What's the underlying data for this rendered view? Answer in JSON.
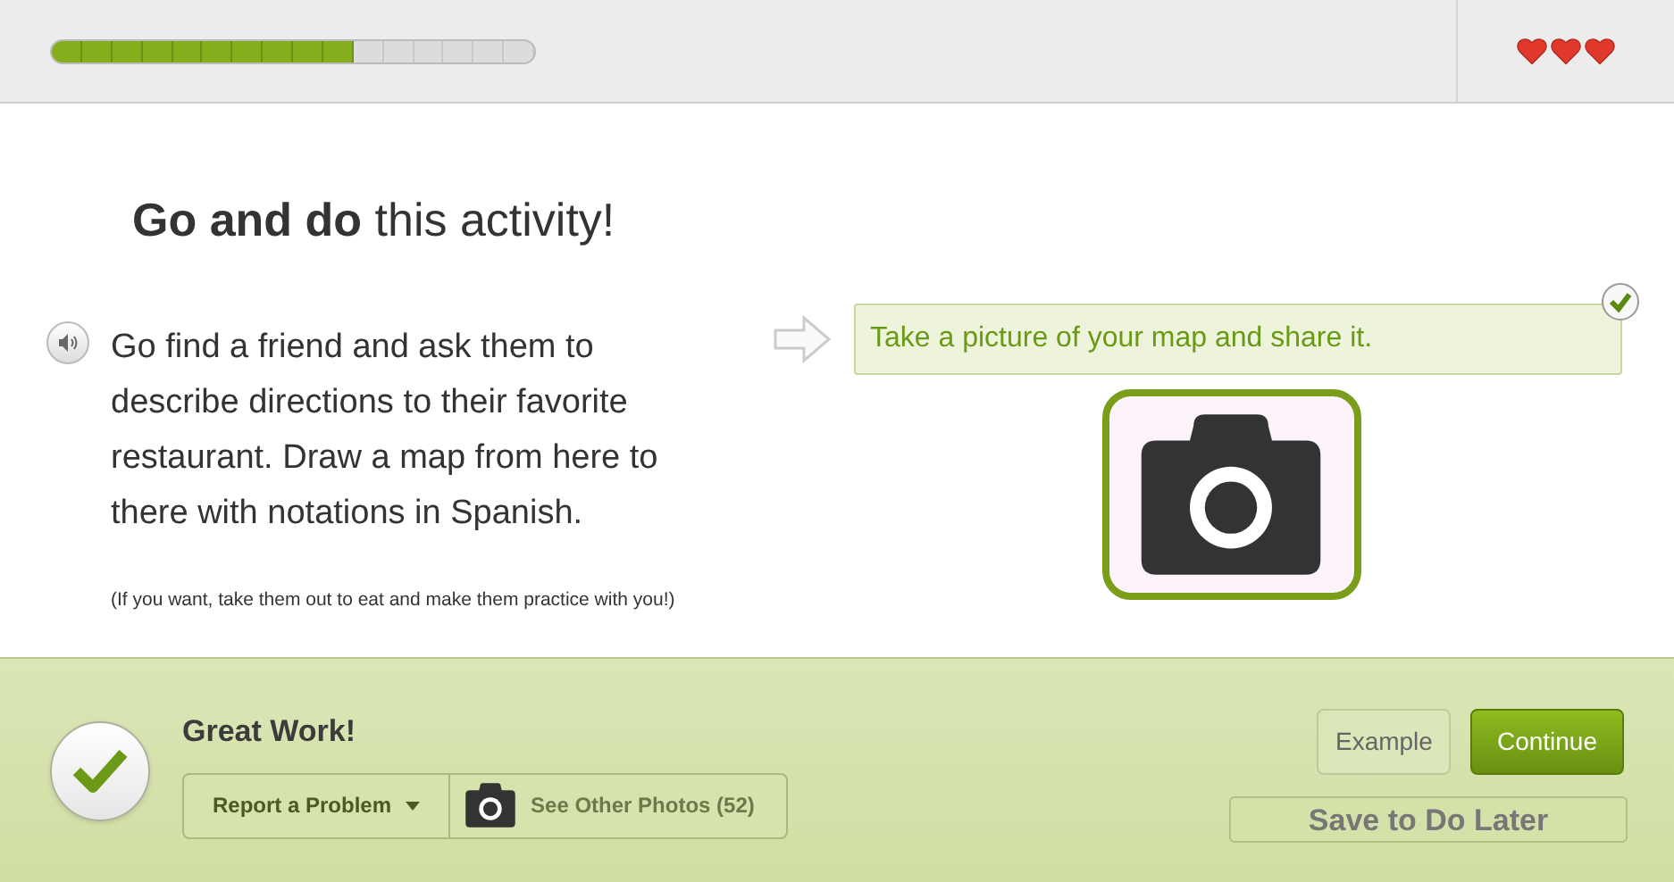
{
  "progress": {
    "level": 0.625
  },
  "lives": [
    {
      "filled": true
    },
    {
      "filled": true
    },
    {
      "filled": true
    }
  ],
  "activity": {
    "title": "**Go and do** this activity!",
    "instructions": "Go find a friend and ask them to describe directions to their favorite restaurant. Draw a map from here to there with notations in Spanish.",
    "note": "(If you want, take them out to eat and make them practice with you!)",
    "task": {
      "text": "Take a picture of your map and share it.",
      "checked": true
    }
  },
  "footer": {
    "status": "Great Work!",
    "report": "Report a Problem",
    "photos": "See Other Photos (52)",
    "example": "Example",
    "continue": "Continue",
    "save": "Save to Do Later"
  }
}
